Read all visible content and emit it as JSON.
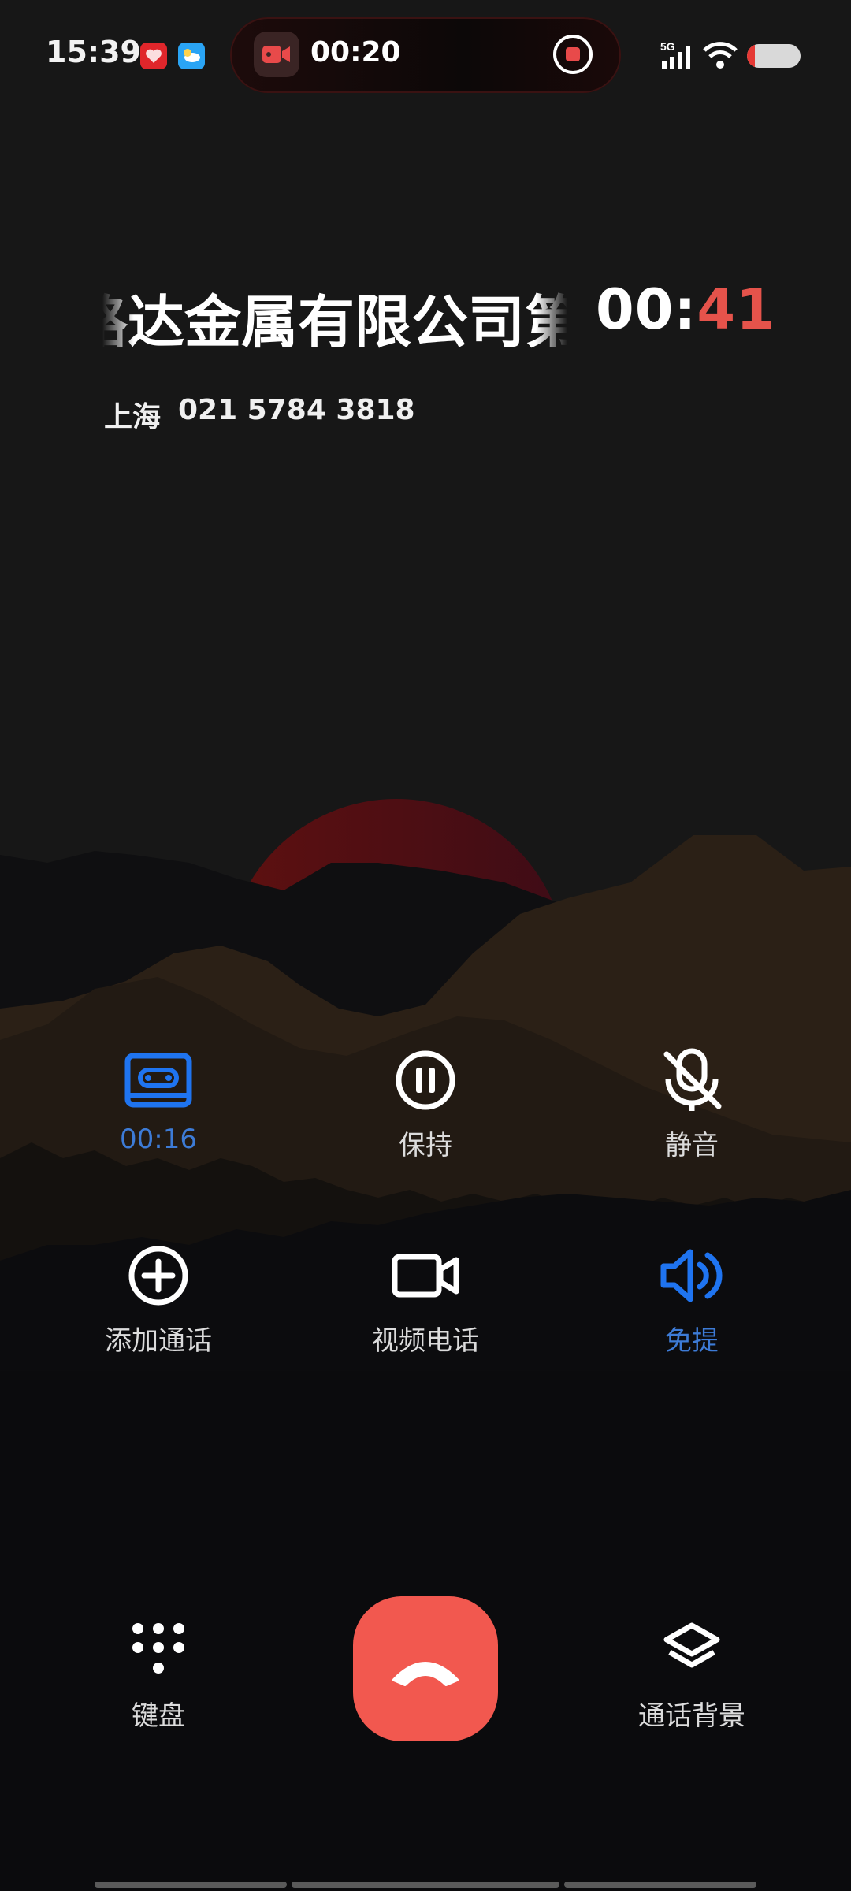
{
  "status_bar": {
    "time": "15:39",
    "recording_elapsed": "00:20",
    "network": "5G"
  },
  "caller": {
    "name": "路达金属有限公司第",
    "timer_prefix": "00:",
    "timer_seconds": "41",
    "location": "上海",
    "number": "021 5784 3818"
  },
  "controls": {
    "record": {
      "label": "00:16",
      "active": true
    },
    "hold": {
      "label": "保持"
    },
    "mute": {
      "label": "静音"
    },
    "add_call": {
      "label": "添加通话"
    },
    "video_call": {
      "label": "视频电话"
    },
    "speaker": {
      "label": "免提",
      "active": true
    }
  },
  "bottom": {
    "keypad": {
      "label": "键盘"
    },
    "background": {
      "label": "通话背景"
    }
  },
  "colors": {
    "accent_blue": "#1f74f0",
    "end_call_red": "#f2584f",
    "timer_red": "#e5534b"
  }
}
